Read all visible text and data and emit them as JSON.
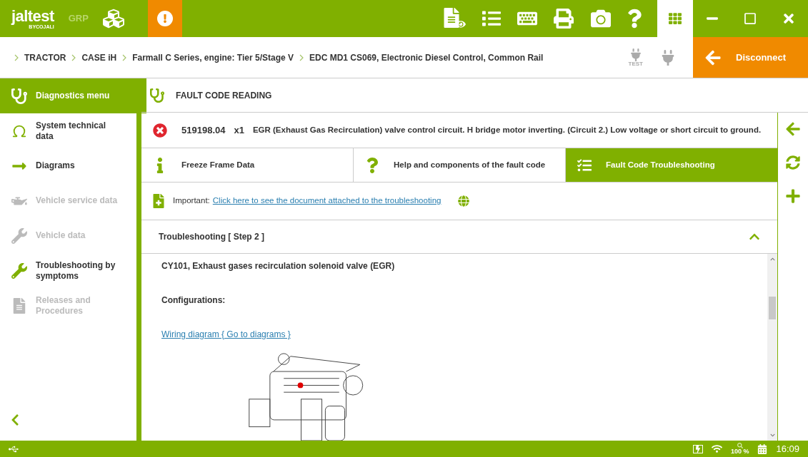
{
  "app_bar": {
    "logo": "jaltest",
    "logo_sub": "BYCOJALI",
    "edition": "GRP"
  },
  "breadcrumb": [
    "TRACTOR",
    "CASE iH",
    "Farmall C Series, engine: Tier 5/Stage V",
    "EDC MD1 CS069, Electronic Diesel Control, Common Rail"
  ],
  "test_label": "TEST",
  "disconnect": "Disconnect",
  "sidebar": {
    "items": [
      {
        "label": "Diagnostics menu",
        "selected": true,
        "disabled": false
      },
      {
        "label": "System technical data",
        "selected": false,
        "disabled": false
      },
      {
        "label": "Diagrams",
        "selected": false,
        "disabled": false
      },
      {
        "label": "Vehicle service data",
        "selected": false,
        "disabled": true
      },
      {
        "label": "Vehicle data",
        "selected": false,
        "disabled": true
      },
      {
        "label": "Troubleshooting by symptoms",
        "selected": false,
        "disabled": false
      },
      {
        "label": "Releases and Procedures",
        "selected": false,
        "disabled": true
      }
    ]
  },
  "section_title": "FAULT CODE READING",
  "fault": {
    "code": "519198.04",
    "count": "x1",
    "description": "EGR (Exhaust Gas Recirculation) valve control circuit. H bridge motor inverting. (Circuit 2.) Low voltage or short circuit to ground."
  },
  "tabs": [
    {
      "label": "Freeze Frame Data",
      "selected": false
    },
    {
      "label": "Help and components of the fault code",
      "selected": false
    },
    {
      "label": "Fault Code Troubleshooting",
      "selected": true
    }
  ],
  "notice": {
    "label": "Important:",
    "link": "Click here to see the document attached to the troubleshooting"
  },
  "troubleshooting": {
    "title": "Troubleshooting [ Step 2 ]",
    "expanded": true,
    "component": "CY101, Exhaust gases recirculation solenoid valve (EGR)",
    "configurations": "Configurations:",
    "link": "Wiring diagram { Go to diagrams }"
  },
  "status_bar": {
    "zoom": "100 %",
    "time": "16:09"
  }
}
